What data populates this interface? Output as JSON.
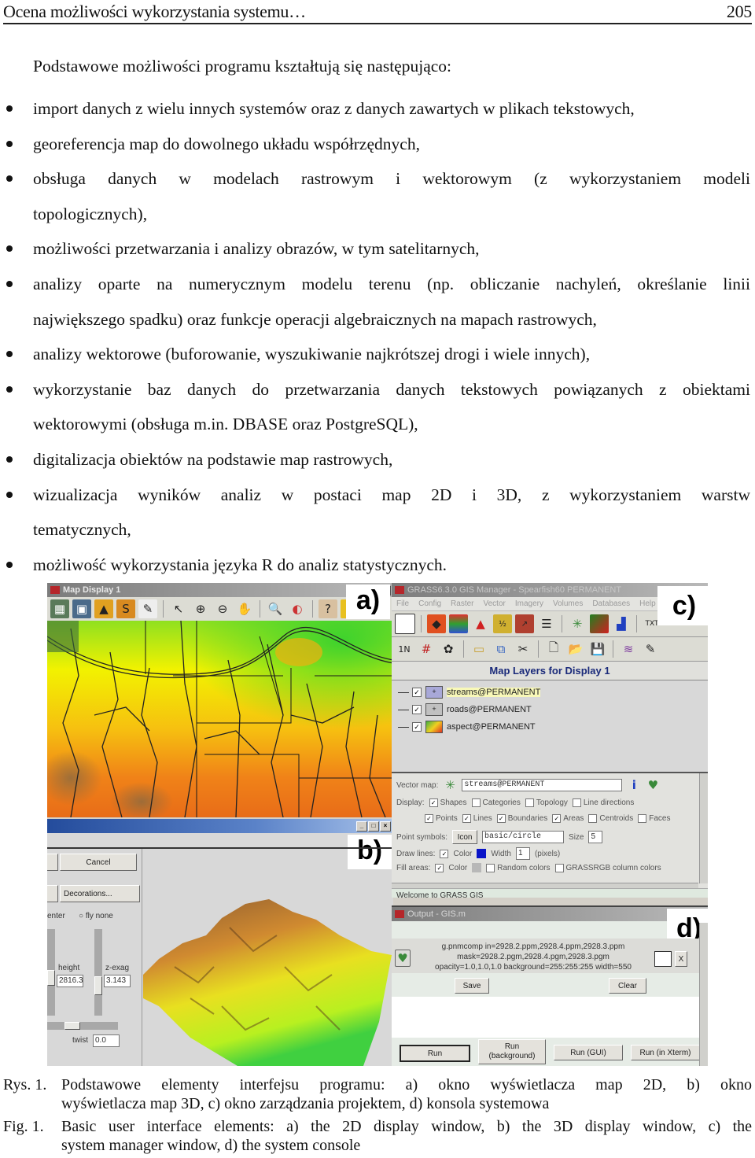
{
  "header": {
    "title": "Ocena możliwości wykorzystania systemu…",
    "page_number": "205"
  },
  "intro": "Podstawowe możliwości programu kształtują się następująco:",
  "bullets": [
    {
      "lines": [
        "import danych z wielu innych systemów oraz z danych zawartych w plikach tekstowych,"
      ]
    },
    {
      "lines": [
        "georeferencja map do dowolnego układu współrzędnych,"
      ]
    },
    {
      "lines": [
        "obsługa danych w modelach rastrowym i wektorowym (z wykorzystaniem modeli",
        "topologicznych),"
      ]
    },
    {
      "lines": [
        "możliwości przetwarzania i analizy obrazów, w tym satelitarnych,"
      ]
    },
    {
      "lines": [
        "analizy oparte na numerycznym modelu terenu (np. obliczanie nachyleń, określanie linii",
        "największego spadku) oraz funkcje operacji algebraicznych na mapach rastrowych,"
      ]
    },
    {
      "lines": [
        "analizy wektorowe (buforowanie, wyszukiwanie najkrótszej drogi i wiele innych),"
      ]
    },
    {
      "lines": [
        "wykorzystanie baz danych do przetwarzania danych tekstowych powiązanych z obiektami",
        "wektorowymi (obsługa m.in. DBASE oraz  PostgreSQL),"
      ]
    },
    {
      "lines": [
        "digitalizacja obiektów na podstawie map rastrowych,"
      ]
    },
    {
      "lines": [
        "wizualizacja wyników analiz w postaci map 2D i 3D, z wykorzystaniem warstw",
        "tematycznych,"
      ]
    },
    {
      "lines": [
        "możliwość wykorzystania języka R do analiz statystycznych."
      ]
    }
  ],
  "figure": {
    "panel_a": {
      "label": "a)",
      "window_title": "Map Display 1",
      "colors": {
        "low": "#1fd01f",
        "mid": "#f5f500",
        "high": "#f07a10",
        "peak": "#8a6a40",
        "lines": "#222222"
      }
    },
    "panel_b": {
      "label": "b)",
      "buttons": {
        "cancel": "Cancel",
        "decorations": "Decorations..."
      },
      "center_label": "enter",
      "fly_label": "fly none",
      "height_label": "height",
      "height_value": "2816.3",
      "zexag_label": "z-exag",
      "zexag_value": "3.143",
      "twist_label": "twist",
      "twist_value": "0.0"
    },
    "panel_c": {
      "label": "c)",
      "window_title": "GRASS6.3.0 GIS Manager - Spearfish60 PERMANENT",
      "menu": [
        "File",
        "Config",
        "Raster",
        "Vector",
        "Imagery",
        "Volumes",
        "Databases",
        "Help"
      ],
      "layers_title": "Map Layers for Display 1",
      "layers": [
        {
          "name": "streams@PERMANENT",
          "checked": true,
          "highlighted": true
        },
        {
          "name": "roads@PERMANENT",
          "checked": true,
          "highlighted": false
        },
        {
          "name": "aspect@PERMANENT",
          "checked": true,
          "highlighted": false
        }
      ],
      "props": {
        "vector_map_label": "Vector map:",
        "vector_map_value": "streams@PERMANENT",
        "display_label": "Display:",
        "display_options": [
          {
            "label": "Shapes",
            "checked": true
          },
          {
            "label": "Categories",
            "checked": false
          },
          {
            "label": "Topology",
            "checked": false
          },
          {
            "label": "Line directions",
            "checked": false
          }
        ],
        "feature_options": [
          {
            "label": "Points",
            "checked": true
          },
          {
            "label": "Lines",
            "checked": true
          },
          {
            "label": "Boundaries",
            "checked": true
          },
          {
            "label": "Areas",
            "checked": true
          },
          {
            "label": "Centroids",
            "checked": false
          },
          {
            "label": "Faces",
            "checked": false
          }
        ],
        "point_symbols_label": "Point symbols:",
        "icon_button": "Icon",
        "symbol_value": "basic/circle",
        "size_label": "Size",
        "size_value": "5",
        "draw_lines_label": "Draw lines:",
        "color_label": "Color",
        "line_color": "#0a14c8",
        "width_label": "Width",
        "width_value": "1",
        "pixels_label": "(pixels)",
        "fill_areas_label": "Fill areas:",
        "fill_color": "#b8b8b8",
        "random_colors_label": "Random colors",
        "grassrgb_label": "GRASSRGB column colors"
      },
      "status": "Welcome to GRASS GIS"
    },
    "panel_d": {
      "label": "d)",
      "window_title": "Output - GIS.m",
      "command_lines": [
        "g.pnmcomp in=2928.2.ppm,2928.4.ppm,2928.3.ppm",
        "mask=2928.2.pgm,2928.4.pgm,2928.3.pgm",
        "opacity=1.0,1.0,1.0 background=255:255:255 width=550"
      ],
      "close_label": "X",
      "save_button": "Save",
      "clear_button": "Clear",
      "run_buttons": [
        "Run",
        "Run\n(background)",
        "Run (GUI)",
        "Run (in Xterm)"
      ]
    }
  },
  "caption_pl": {
    "prefix": "Rys. 1.",
    "line1": "Podstawowe elementy interfejsu programu: a) okno wyświetlacza map 2D, b) okno",
    "line2": "wyświetlacza map 3D, c) okno zarządzania projektem, d) konsola systemowa"
  },
  "caption_en": {
    "prefix": "Fig. 1.",
    "line1": "Basic user interface elements: a) the 2D display window, b) the 3D display window, c) the",
    "line2": "system manager window, d) the system console"
  }
}
